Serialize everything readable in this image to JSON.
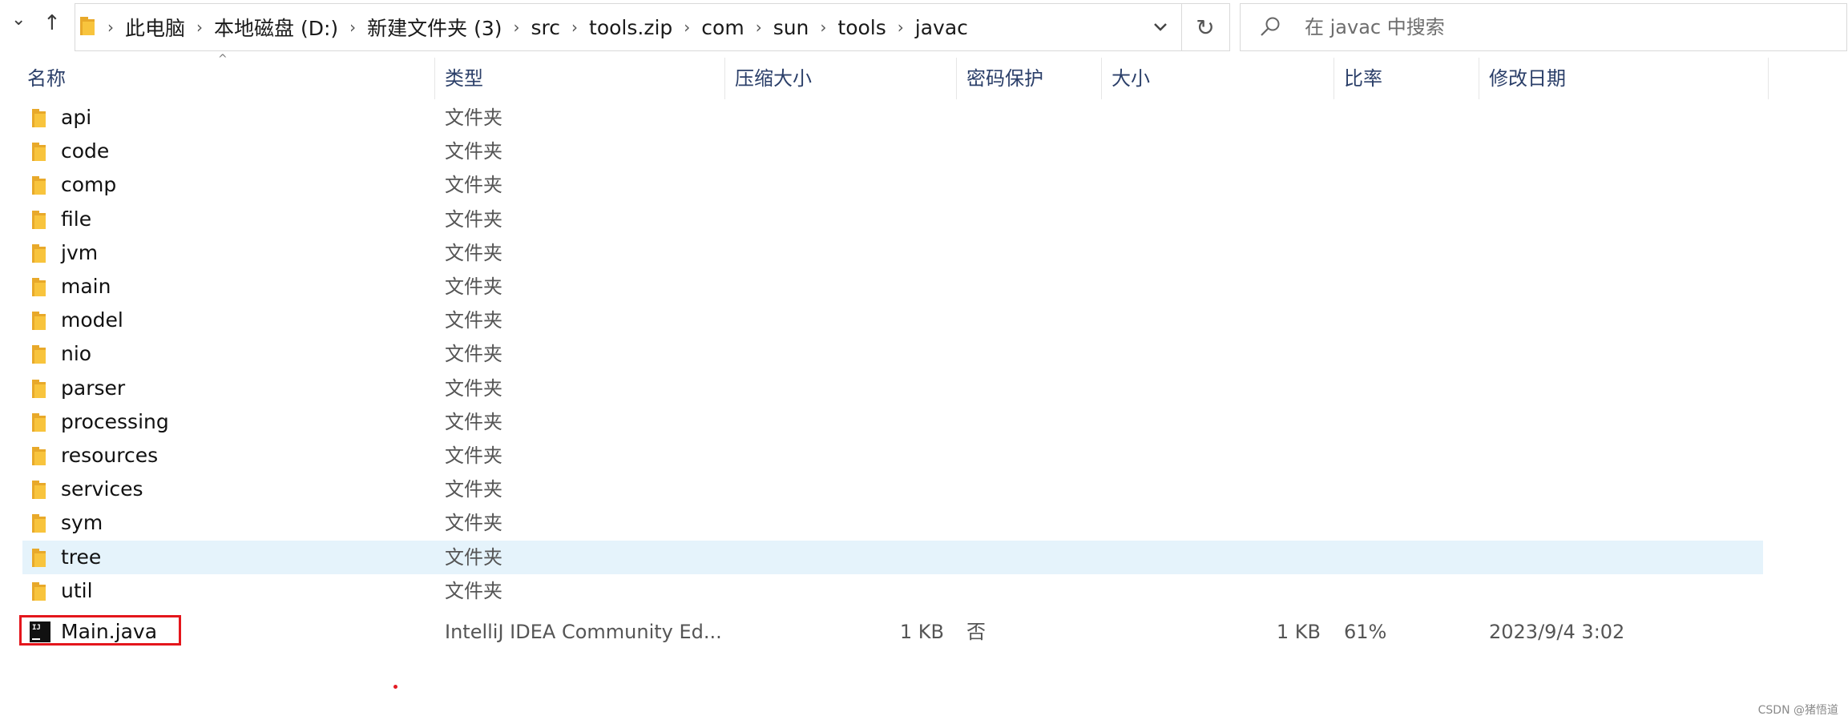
{
  "nav": {
    "down_glyph": "⌄",
    "up_glyph": "↑"
  },
  "address": {
    "breadcrumbs": [
      "此电脑",
      "本地磁盘 (D:)",
      "新建文件夹 (3)",
      "src",
      "tools.zip",
      "com",
      "sun",
      "tools",
      "javac"
    ],
    "separator": "›",
    "refresh_glyph": "↻"
  },
  "search": {
    "placeholder": "在 javac 中搜索"
  },
  "columns": {
    "name": "名称",
    "type": "类型",
    "compressed_size": "压缩大小",
    "password": "密码保护",
    "size": "大小",
    "ratio": "比率",
    "modified": "修改日期",
    "sort_glyph": "^"
  },
  "folders": [
    {
      "name": "api",
      "type": "文件夹"
    },
    {
      "name": "code",
      "type": "文件夹"
    },
    {
      "name": "comp",
      "type": "文件夹"
    },
    {
      "name": "file",
      "type": "文件夹"
    },
    {
      "name": "jvm",
      "type": "文件夹"
    },
    {
      "name": "main",
      "type": "文件夹"
    },
    {
      "name": "model",
      "type": "文件夹"
    },
    {
      "name": "nio",
      "type": "文件夹"
    },
    {
      "name": "parser",
      "type": "文件夹"
    },
    {
      "name": "processing",
      "type": "文件夹"
    },
    {
      "name": "resources",
      "type": "文件夹"
    },
    {
      "name": "services",
      "type": "文件夹"
    },
    {
      "name": "sym",
      "type": "文件夹"
    },
    {
      "name": "tree",
      "type": "文件夹",
      "selected": true
    },
    {
      "name": "util",
      "type": "文件夹"
    }
  ],
  "file": {
    "name": "Main.java",
    "type": "IntelliJ IDEA Community Ed...",
    "compressed_size": "1 KB",
    "password": "否",
    "size": "1 KB",
    "ratio": "61%",
    "modified": "2023/9/4 3:02",
    "icon_text": "IJ"
  },
  "colors": {
    "selection": "#e5f3fb",
    "highlight_border": "#e4161c",
    "folder": "#f8c43d",
    "header_text": "#2b3f69"
  },
  "watermark": "CSDN @猪悟道"
}
